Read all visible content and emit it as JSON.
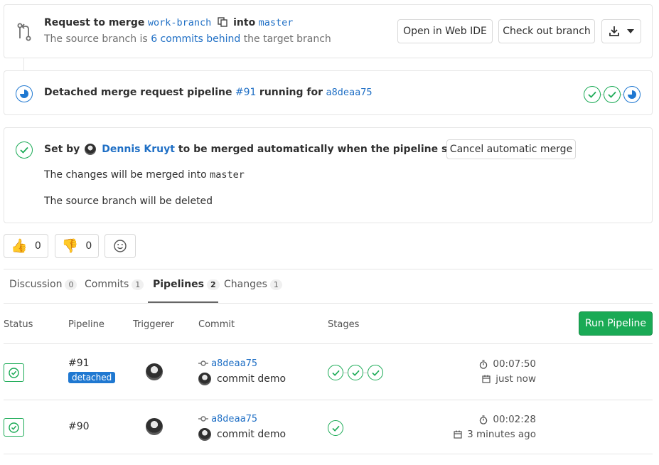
{
  "merge_header": {
    "request_prefix": "Request to merge",
    "source_branch": "work-branch",
    "into_word": "into",
    "target_branch": "master",
    "behind_prefix": "The source branch is",
    "behind_link": "6 commits behind",
    "behind_suffix": "the target branch",
    "open_web_ide_label": "Open in Web IDE",
    "check_out_label": "Check out branch"
  },
  "pipeline_banner": {
    "prefix": "Detached merge request pipeline",
    "pipeline_id": "#91",
    "running_for": "running for",
    "commit_sha": "a8deaa75"
  },
  "auto_merge": {
    "set_by": "Set by",
    "user_name": "Dennis Kruyt",
    "message": "to be merged automatically when the pipeline succeeds",
    "cancel_label": "Cancel automatic merge",
    "merged_into_prefix": "The changes will be merged into",
    "merged_into_branch": "master",
    "source_deleted": "The source branch will be deleted"
  },
  "reactions": {
    "thumbs_up_count": "0",
    "thumbs_down_count": "0"
  },
  "tabs": [
    {
      "label": "Discussion",
      "count": "0"
    },
    {
      "label": "Commits",
      "count": "1"
    },
    {
      "label": "Pipelines",
      "count": "2",
      "active": true
    },
    {
      "label": "Changes",
      "count": "1"
    }
  ],
  "table": {
    "headers": {
      "status": "Status",
      "pipeline": "Pipeline",
      "triggerer": "Triggerer",
      "commit": "Commit",
      "stages": "Stages"
    },
    "run_pipeline_label": "Run Pipeline",
    "rows": [
      {
        "pipeline_id": "#91",
        "tag": "detached",
        "commit_sha": "a8deaa75",
        "commit_title": "commit demo",
        "stages_passed": 3,
        "duration": "00:07:50",
        "finished": "just now"
      },
      {
        "pipeline_id": "#90",
        "commit_sha": "a8deaa75",
        "commit_title": "commit demo",
        "stages_passed": 1,
        "duration": "00:02:28",
        "finished": "3 minutes ago"
      }
    ]
  },
  "colors": {
    "link": "#1f6fc5",
    "success": "#1aaa55",
    "running": "#1f78d1",
    "primary_button": "#1aaa55"
  }
}
